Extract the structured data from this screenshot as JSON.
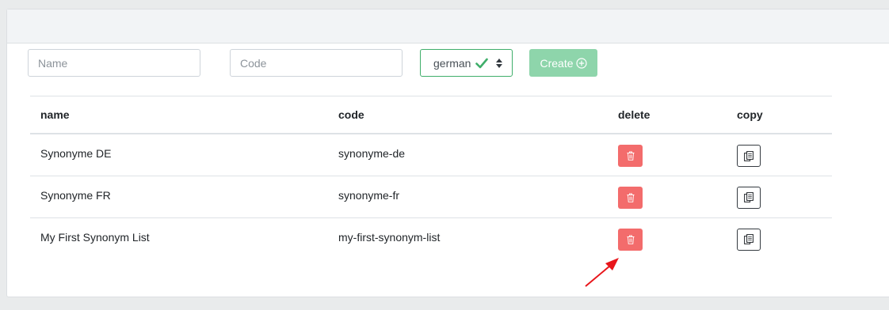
{
  "form": {
    "name_placeholder": "Name",
    "code_placeholder": "Code",
    "language_selected": "german",
    "create_label": "Create"
  },
  "table": {
    "headers": [
      "name",
      "code",
      "delete",
      "copy"
    ],
    "rows": [
      {
        "name": "Synonyme DE",
        "code": "synonyme-de"
      },
      {
        "name": "Synonyme FR",
        "code": "synonyme-fr"
      },
      {
        "name": "My First Synonym List",
        "code": "my-first-synonym-list"
      }
    ]
  },
  "colors": {
    "accent_green": "#3fae6a",
    "create_button": "#8ed5ab",
    "delete_button": "#f36c6c",
    "annotation_arrow": "#e8161b"
  },
  "icons": {
    "check": "check-icon",
    "select_arrows": "sort-arrows-icon",
    "create": "plus-circle-icon",
    "delete": "trash-icon",
    "copy": "copy-icon"
  }
}
